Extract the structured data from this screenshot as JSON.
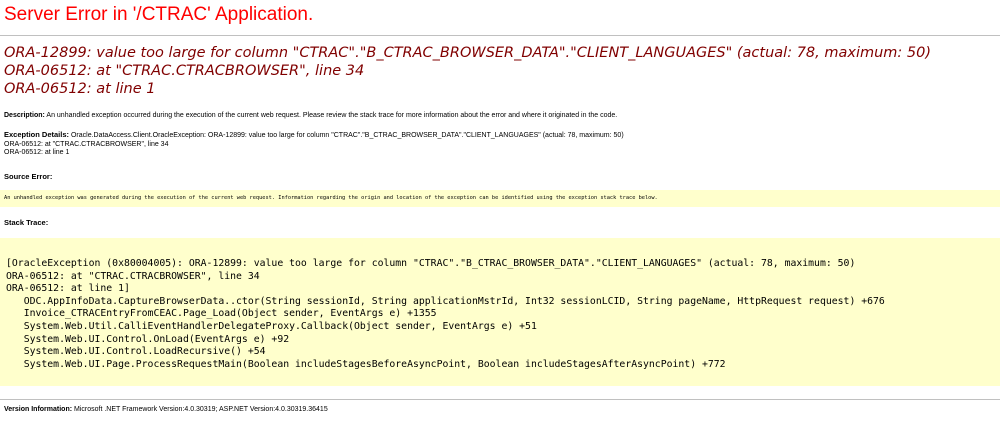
{
  "title": "Server Error in '/CTRAC' Application.",
  "error_message_lines": [
    "ORA-12899: value too large for column \"CTRAC\".\"B_CTRAC_BROWSER_DATA\".\"CLIENT_LANGUAGES\" (actual: 78, maximum: 50)",
    "ORA-06512: at \"CTRAC.CTRACBROWSER\", line 34",
    "ORA-06512: at line 1"
  ],
  "description": {
    "label": "Description:",
    "text": " An unhandled exception occurred during the execution of the current web request. Please review the stack trace for more information about the error and where it originated in the code."
  },
  "exception_details": {
    "label": "Exception Details:",
    "text": " Oracle.DataAccess.Client.OracleException: ORA-12899: value too large for column \"CTRAC\".\"B_CTRAC_BROWSER_DATA\".\"CLIENT_LANGUAGES\" (actual: 78, maximum: 50)",
    "line2": "ORA-06512: at \"CTRAC.CTRACBROWSER\", line 34",
    "line3": "ORA-06512: at line 1"
  },
  "source_error": {
    "label": "Source Error:",
    "text": "An unhandled exception was generated during the execution of the current web request. Information regarding the origin and location of the exception can be identified using the exception stack trace below."
  },
  "stack_trace": {
    "label": "Stack Trace:",
    "lines": [
      "[OracleException (0x80004005): ORA-12899: value too large for column \"CTRAC\".\"B_CTRAC_BROWSER_DATA\".\"CLIENT_LANGUAGES\" (actual: 78, maximum: 50)",
      "ORA-06512: at \"CTRAC.CTRACBROWSER\", line 34",
      "ORA-06512: at line 1]",
      "   ODC.AppInfoData.CaptureBrowserData..ctor(String sessionId, String applicationMstrId, Int32 sessionLCID, String pageName, HttpRequest request) +676",
      "   Invoice_CTRACEntryFromCEAC.Page_Load(Object sender, EventArgs e) +1355",
      "   System.Web.Util.CalliEventHandlerDelegateProxy.Callback(Object sender, EventArgs e) +51",
      "   System.Web.UI.Control.OnLoad(EventArgs e) +92",
      "   System.Web.UI.Control.LoadRecursive() +54",
      "   System.Web.UI.Page.ProcessRequestMain(Boolean includeStagesBeforeAsyncPoint, Boolean includeStagesAfterAsyncPoint) +772"
    ]
  },
  "version_info": {
    "label": "Version Information:",
    "text": " Microsoft .NET Framework Version:4.0.30319; ASP.NET Version:4.0.30319.36415"
  },
  "colors": {
    "title": "#ff0000",
    "error_message": "#800000",
    "code_background": "#ffffcc"
  }
}
